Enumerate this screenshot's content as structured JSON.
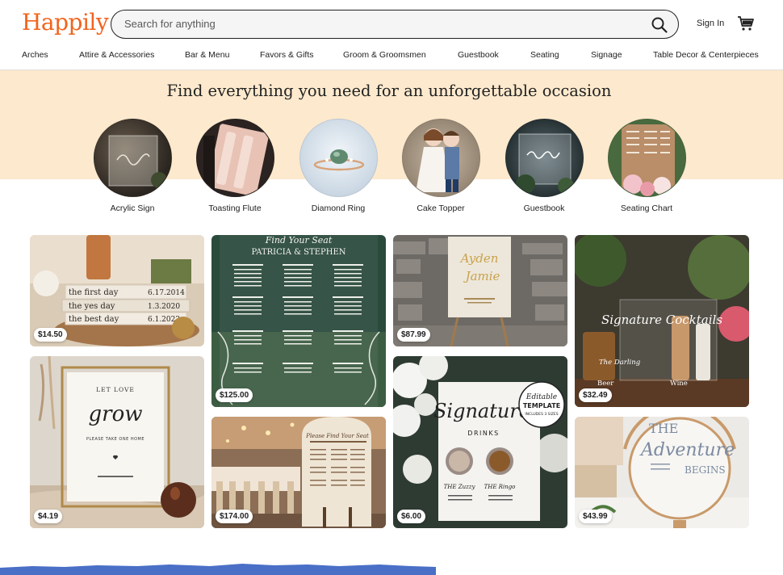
{
  "header": {
    "logo": "Happily",
    "search_placeholder": "Search for anything",
    "sign_in": "Sign In"
  },
  "nav": {
    "items": [
      "Arches",
      "Attire & Accessories",
      "Bar & Menu",
      "Favors & Gifts",
      "Groom & Groomsmen",
      "Guestbook",
      "Seating",
      "Signage",
      "Table Decor & Centerpieces"
    ]
  },
  "hero": {
    "title": "Find everything you need for an unforgettable occasion",
    "categories": [
      {
        "label": "Acrylic Sign"
      },
      {
        "label": "Toasting Flute"
      },
      {
        "label": "Diamond Ring"
      },
      {
        "label": "Cake Topper"
      },
      {
        "label": "Guestbook"
      },
      {
        "label": "Seating Chart"
      }
    ]
  },
  "listings": [
    {
      "price": "$14.50",
      "image_text": [
        "the first day",
        "the yes day",
        "the best day",
        "6.17.2014",
        "1.3.2020",
        "6.1.2022"
      ]
    },
    {
      "price": "$125.00",
      "image_text": [
        "Find Your Seat",
        "PATRICIA & STEPHEN"
      ]
    },
    {
      "price": "$87.99",
      "image_text": [
        "Ayden",
        "Jamie"
      ]
    },
    {
      "price": "$32.49",
      "image_text": [
        "Signature Cocktails",
        "The Darling",
        "Beer",
        "Wine"
      ]
    },
    {
      "price": "$4.19",
      "image_text": [
        "LET LOVE",
        "grow",
        "PLEASE TAKE ONE HOME"
      ]
    },
    {
      "price": "$174.00",
      "image_text": [
        "Please Find Your Seat"
      ]
    },
    {
      "price": "$6.00",
      "image_text": [
        "Signature",
        "DRINKS",
        "Editable",
        "TEMPLATE",
        "INCLUDES 3 SIZES",
        "THE Zuzzy",
        "THE Ringo"
      ]
    },
    {
      "price": "$43.99",
      "image_text": [
        "THE",
        "Adventure",
        "BEGINS"
      ]
    }
  ],
  "colors": {
    "brand": "#f1641e",
    "hero_bg": "#fde9cd",
    "wave": "#4a6fc7"
  },
  "icons": {
    "search": "search-icon",
    "cart": "cart-icon"
  }
}
